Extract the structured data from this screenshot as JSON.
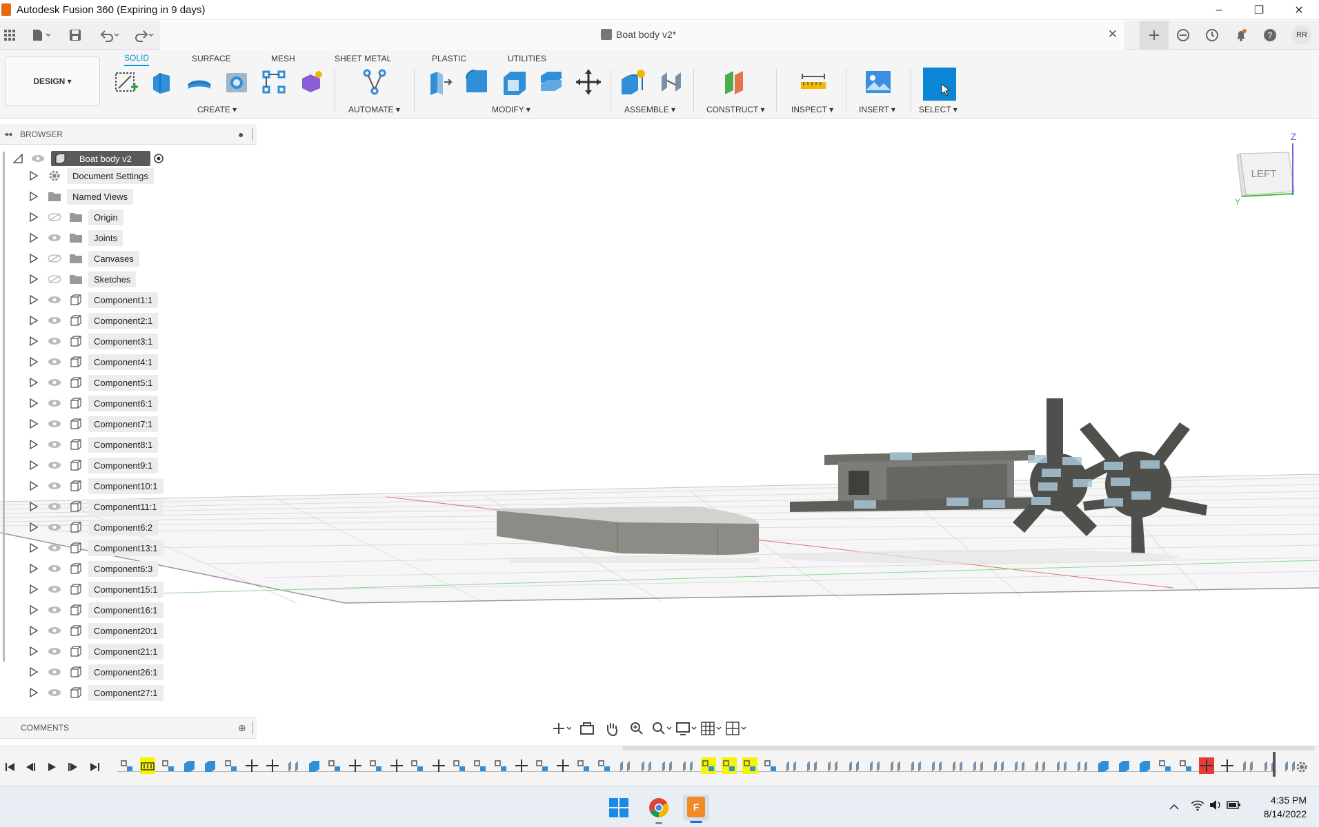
{
  "window": {
    "title": "Autodesk Fusion 360 (Expiring in 9 days)",
    "controls": [
      "–",
      "❐",
      "✕"
    ]
  },
  "appbar": {
    "document_title": "Boat body v2*",
    "close_tab": "✕",
    "avatar": "RR"
  },
  "ribbon": {
    "workspace": "DESIGN ▾",
    "tabs": [
      "SOLID",
      "SURFACE",
      "MESH",
      "SHEET METAL",
      "PLASTIC",
      "UTILITIES"
    ],
    "active_tab": "SOLID",
    "groups": {
      "create": "CREATE ▾",
      "automate": "AUTOMATE ▾",
      "modify": "MODIFY ▾",
      "assemble": "ASSEMBLE ▾",
      "construct": "CONSTRUCT ▾",
      "inspect": "INSPECT ▾",
      "insert": "INSERT ▾",
      "select": "SELECT ▾"
    },
    "accent": "#0696d7"
  },
  "browser": {
    "header": "BROWSER",
    "root": "Boat body v2",
    "items": [
      {
        "label": "Document Settings",
        "type": "gear"
      },
      {
        "label": "Named Views",
        "type": "folder"
      },
      {
        "label": "Origin",
        "type": "folder",
        "hidden": true
      },
      {
        "label": "Joints",
        "type": "folder"
      },
      {
        "label": "Canvases",
        "type": "folder",
        "hidden": true
      },
      {
        "label": "Sketches",
        "type": "folder",
        "hidden": true
      },
      {
        "label": "Component1:1",
        "type": "component"
      },
      {
        "label": "Component2:1",
        "type": "component"
      },
      {
        "label": "Component3:1",
        "type": "component"
      },
      {
        "label": "Component4:1",
        "type": "component"
      },
      {
        "label": "Component5:1",
        "type": "component"
      },
      {
        "label": "Component6:1",
        "type": "component"
      },
      {
        "label": "Component7:1",
        "type": "component"
      },
      {
        "label": "Component8:1",
        "type": "component"
      },
      {
        "label": "Component9:1",
        "type": "component"
      },
      {
        "label": "Component10:1",
        "type": "component"
      },
      {
        "label": "Component11:1",
        "type": "component"
      },
      {
        "label": "Component6:2",
        "type": "component"
      },
      {
        "label": "Component13:1",
        "type": "component"
      },
      {
        "label": "Component6:3",
        "type": "component"
      },
      {
        "label": "Component15:1",
        "type": "component"
      },
      {
        "label": "Component16:1",
        "type": "component"
      },
      {
        "label": "Component20:1",
        "type": "component"
      },
      {
        "label": "Component21:1",
        "type": "component"
      },
      {
        "label": "Component26:1",
        "type": "component"
      },
      {
        "label": "Component27:1",
        "type": "component"
      }
    ]
  },
  "comments": {
    "header": "COMMENTS"
  },
  "viewcube": {
    "face": "LEFT",
    "axis_z": "Z",
    "axis_y": "Y"
  },
  "taskbar": {
    "time": "4:35 PM",
    "date": "8/14/2022"
  }
}
